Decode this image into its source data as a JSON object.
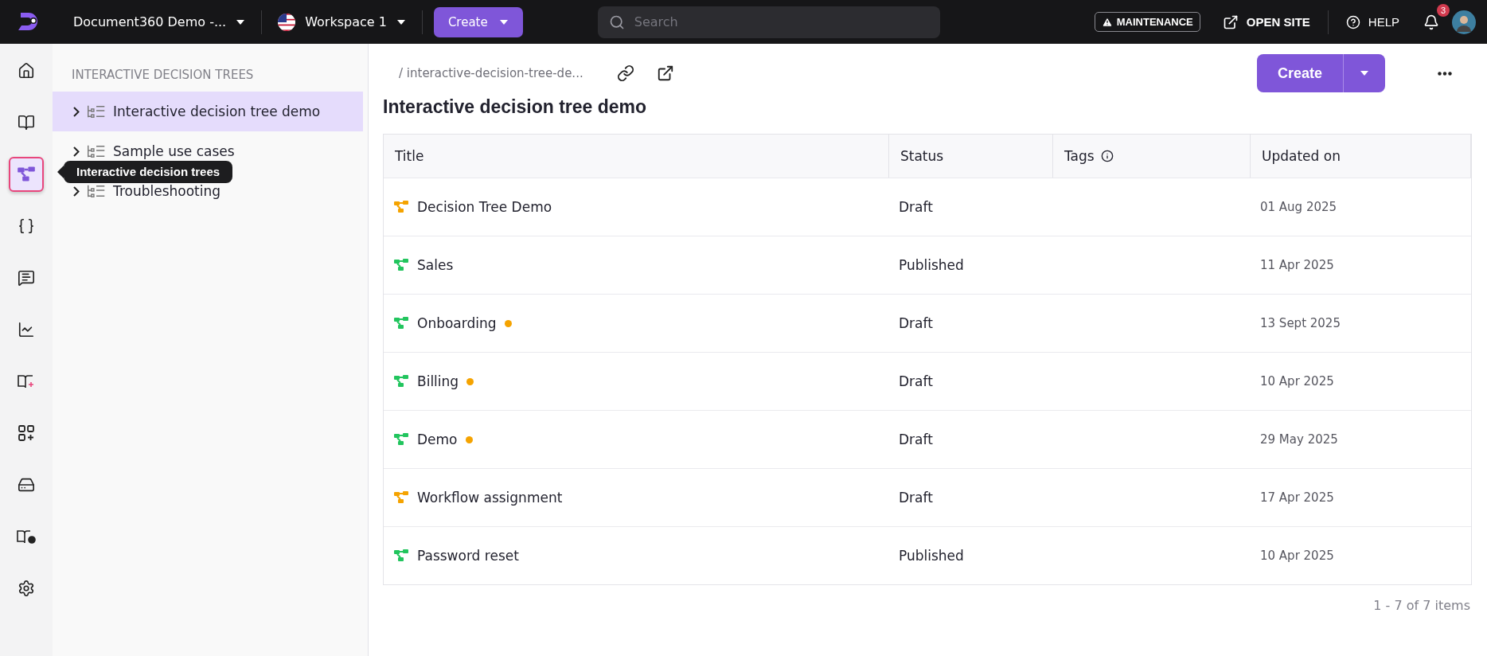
{
  "topbar": {
    "project": "Document360 Demo -...",
    "workspace": "Workspace 1",
    "create": "Create",
    "search": {
      "placeholder": "Search"
    },
    "maintenance": "MAINTENANCE",
    "open_site": "OPEN SITE",
    "help": "HELP",
    "notifications": "3"
  },
  "rail": [
    {
      "selected": false
    },
    {
      "selected": false
    },
    {
      "selected": true
    },
    {
      "selected": false
    },
    {
      "selected": false
    },
    {
      "selected": false
    },
    {
      "selected": false
    },
    {
      "selected": false
    },
    {
      "selected": false
    },
    {
      "selected": false
    },
    {
      "selected": false
    }
  ],
  "tooltip": "Interactive decision trees",
  "tree": {
    "heading": "INTERACTIVE DECISION TREES",
    "items": [
      {
        "label": "Interactive decision tree demo",
        "selected": true
      },
      {
        "label": "Sample use cases",
        "selected": false
      },
      {
        "label": "Troubleshooting",
        "selected": false
      }
    ]
  },
  "main": {
    "breadcrumb": "/ interactive-decision-tree-de...",
    "title": "Interactive decision tree demo",
    "create": "Create",
    "table": {
      "columns": [
        "Title",
        "Status",
        "Tags",
        "Updated on"
      ],
      "rows": [
        {
          "title": "Decision Tree Demo",
          "color": "#f5a300",
          "dot": false,
          "status": "Draft",
          "updated": "01 Aug 2025"
        },
        {
          "title": "Sales",
          "color": "#22c55e",
          "dot": false,
          "status": "Published",
          "updated": "11 Apr 2025"
        },
        {
          "title": "Onboarding",
          "color": "#22c55e",
          "dot": true,
          "status": "Draft",
          "updated": "13 Sept 2025"
        },
        {
          "title": "Billing",
          "color": "#22c55e",
          "dot": true,
          "status": "Draft",
          "updated": "10 Apr 2025"
        },
        {
          "title": "Demo",
          "color": "#22c55e",
          "dot": true,
          "status": "Draft",
          "updated": "29 May 2025"
        },
        {
          "title": "Workflow assignment",
          "color": "#f5a300",
          "dot": false,
          "status": "Draft",
          "updated": "17 Apr 2025"
        },
        {
          "title": "Password reset",
          "color": "#22c55e",
          "dot": false,
          "status": "Published",
          "updated": "10 Apr 2025"
        }
      ]
    },
    "pager": "1 - 7 of 7 items"
  }
}
